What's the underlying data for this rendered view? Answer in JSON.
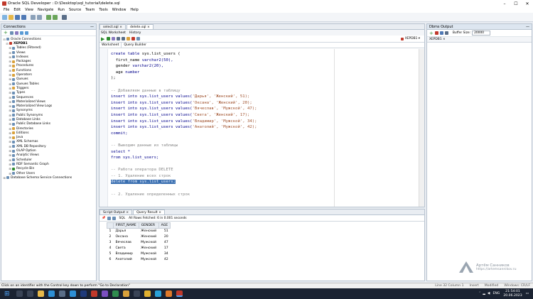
{
  "app": {
    "title": "Oracle SQL Developer : D:\\Desktop\\sql_tutorial\\delete.sql"
  },
  "menu": [
    "File",
    "Edit",
    "View",
    "Navigate",
    "Run",
    "Source",
    "Team",
    "Tools",
    "Window",
    "Help"
  ],
  "connections": {
    "title": "Connections",
    "root": "Oracle Connections",
    "conn": "XEPDB1",
    "items": [
      "Tables (Filtered)",
      "Views",
      "Indexes",
      "Packages",
      "Procedures",
      "Functions",
      "Operators",
      "Queues",
      "Queues Tables",
      "Triggers",
      "Types",
      "Sequences",
      "Materialized Views",
      "Materialized View Logs",
      "Synonyms",
      "Public Synonyms",
      "Database Links",
      "Public Database Links",
      "Directories",
      "Editions",
      "Java",
      "XML Schemas",
      "XML DB Repository",
      "OLAP Option",
      "Analytic Views",
      "Scheduler",
      "RDF Semantic Graph",
      "Recycle Bin",
      "Other Users"
    ],
    "footer": "Database Schema Service Connections"
  },
  "editor": {
    "tabs": [
      "select.sql",
      "delete.sql"
    ],
    "subtabs": [
      "SQL Worksheet",
      "History"
    ],
    "wtabs": [
      "Worksheet",
      "Query Builder"
    ],
    "conn": "XEPDB1"
  },
  "code": {
    "l1a": "create table",
    "l1b": " sys.list_users (",
    "l2a": "  first_name ",
    "l2b": "varchar2(50),",
    "l3a": "  gender ",
    "l3b": "varchar2(20),",
    "l4a": "  age ",
    "l4b": "number",
    "l5": ");",
    "c1": "-- Добавляем данные в таблицу",
    "ins": "insert into sys.list_users values(",
    "i1": "'Дарья', 'Женский', 51);",
    "i2": "'Оксана', 'Женский', 20);",
    "i3": "'Вячеслав', 'Мужской', 47);",
    "i4": "'Света', 'Женский', 17);",
    "i5": "'Владимир', 'Мужской', 34);",
    "i6": "'Анатолий', 'Мужской', 42);",
    "commit": "commit;",
    "c2": "-- Выводим данные из таблицы",
    "sel1": "select *",
    "sel2": "from sys.list_users;",
    "c3": "-- Работа оператора DELETE",
    "c4": "-- 1. Удаление всех строк",
    "del": "delete from sys.list_users;",
    "c5": "-- 2. Удаление определенных строк"
  },
  "results": {
    "tabs": [
      "Script Output",
      "Query Result"
    ],
    "info": "All Rows Fetched: 6 in 0.001 seconds",
    "sql_label": "SQL",
    "headers": [
      "FIRST_NAME",
      "GENDER",
      "AGE"
    ],
    "rows": [
      [
        "1",
        "Дарья",
        "Женский",
        "51"
      ],
      [
        "2",
        "Оксана",
        "Женский",
        "20"
      ],
      [
        "3",
        "Вячеслав",
        "Мужской",
        "47"
      ],
      [
        "4",
        "Света",
        "Женский",
        "17"
      ],
      [
        "5",
        "Владимир",
        "Мужской",
        "34"
      ],
      [
        "6",
        "Анатолий",
        "Мужской",
        "42"
      ]
    ]
  },
  "dbms": {
    "title": "Dbms Output",
    "buffer_label": "Buffer Size:",
    "buffer_value": "20000",
    "conn": "XEPDB1"
  },
  "watermark": {
    "name": "Артём Санников",
    "url": "https://artemsannikov.ru"
  },
  "status": {
    "text": "Click on an identifier with the Control key down to perform \"Go to Declaration\"",
    "pos": "Line 32 Column 1",
    "mode": "Insert",
    "mod": "Modified",
    "enc": "Windows: CR/LF"
  },
  "taskbar": {
    "lang": "ENG",
    "time": "21:54:01",
    "date": "20.06.2023"
  },
  "colors": {
    "accent": "#3a6fb0",
    "taskbar": "#1b2332"
  }
}
